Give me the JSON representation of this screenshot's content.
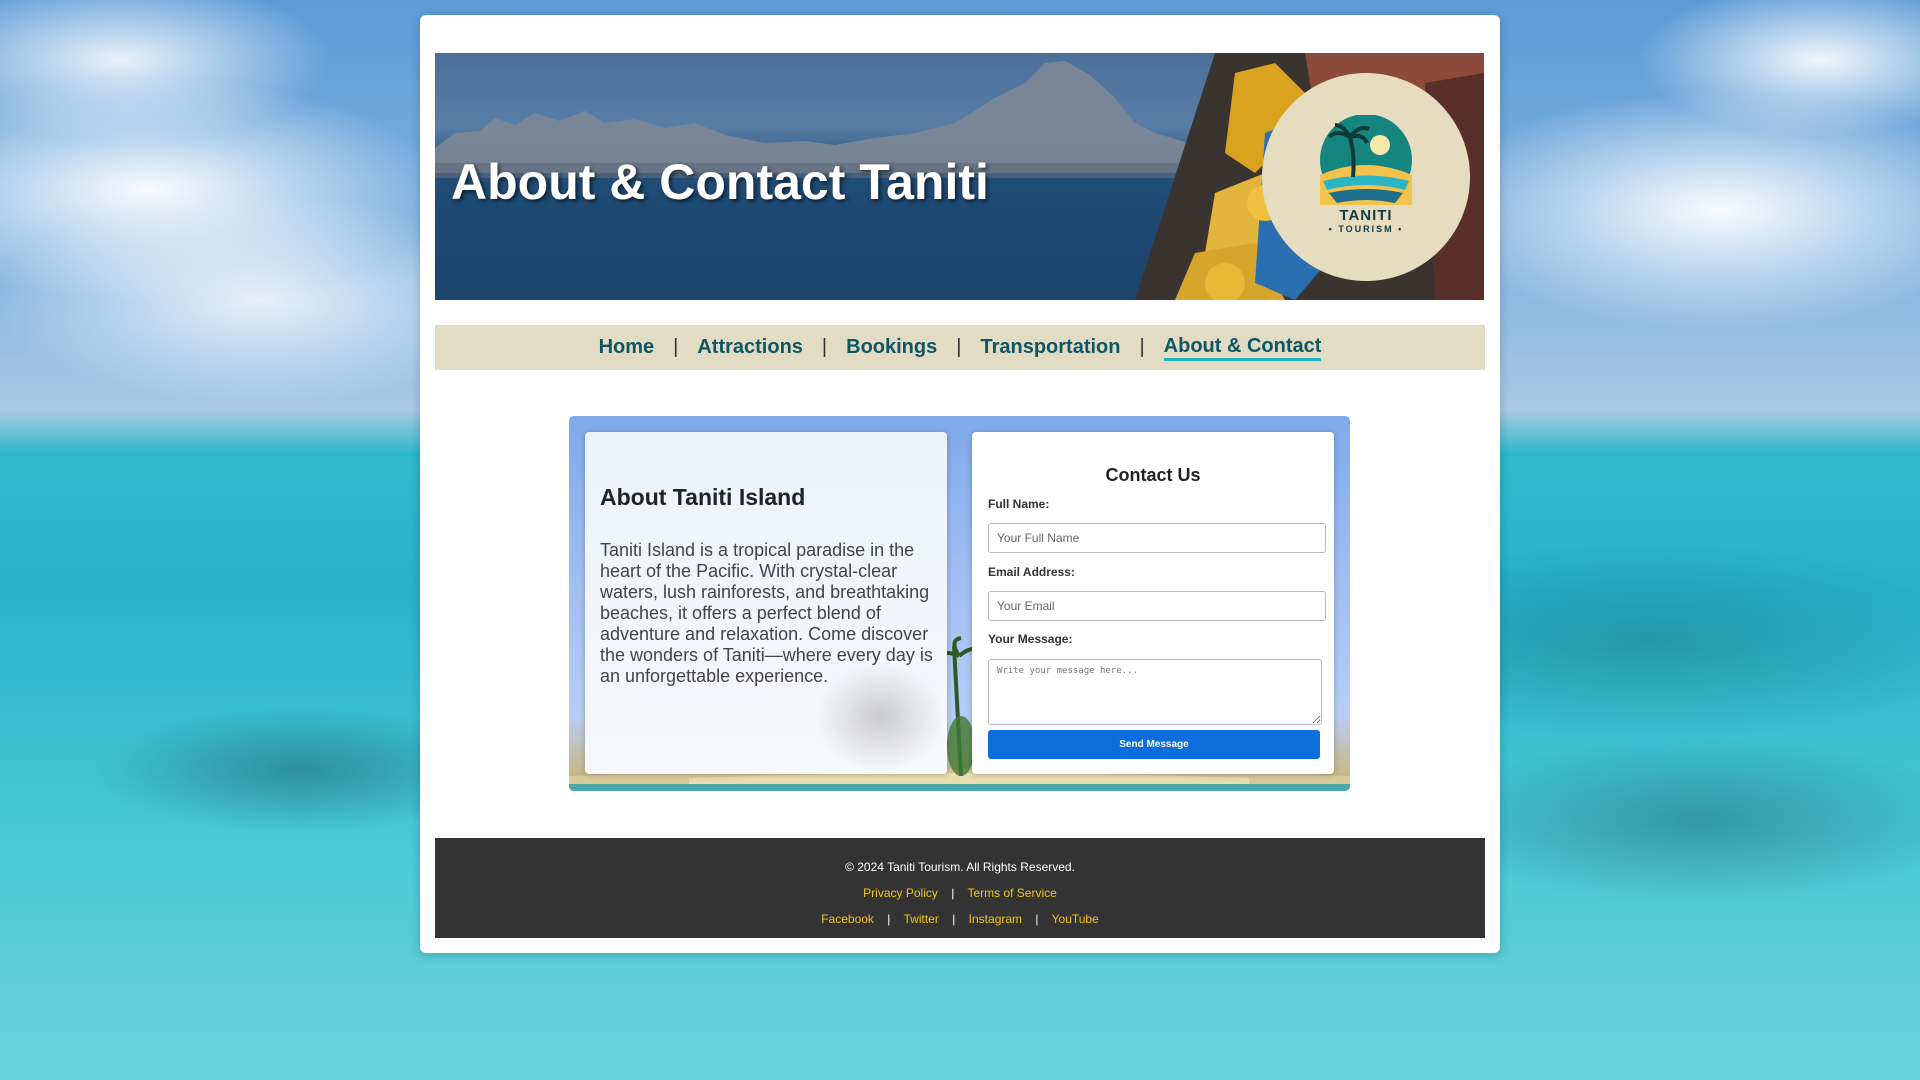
{
  "banner": {
    "title": "About & Contact Taniti",
    "logo_name": "TANITI",
    "logo_sub": "• TOURISM •"
  },
  "nav": {
    "items": [
      {
        "label": "Home"
      },
      {
        "label": "Attractions"
      },
      {
        "label": "Bookings"
      },
      {
        "label": "Transportation"
      },
      {
        "label": "About & Contact",
        "active": true
      }
    ],
    "separator": "|"
  },
  "about": {
    "heading": "About Taniti Island",
    "body": "Taniti Island is a tropical paradise in the heart of the Pacific. With crystal-clear waters, lush rainforests, and breathtaking beaches, it offers a perfect blend of adventure and relaxation. Come discover the wonders of Taniti—where every day is an unforgettable experience."
  },
  "contact": {
    "heading": "Contact Us",
    "name_label": "Full Name:",
    "name_placeholder": "Your Full Name",
    "email_label": "Email Address:",
    "email_placeholder": "Your Email",
    "message_label": "Your Message:",
    "message_placeholder": "Write your message here...",
    "submit_label": "Send Message"
  },
  "footer": {
    "copyright": "© 2024 Taniti Tourism. All Rights Reserved.",
    "policy_links": [
      "Privacy Policy",
      "Terms of Service"
    ],
    "social_links": [
      "Facebook",
      "Twitter",
      "Instagram",
      "YouTube"
    ],
    "separator": "|"
  },
  "colors": {
    "nav_bg": "#e2dcc4",
    "nav_link": "#0f5563",
    "nav_active_underline": "#20b3c8",
    "button": "#0b6edc",
    "footer_bg": "#333333",
    "footer_link": "#f3c51a"
  }
}
